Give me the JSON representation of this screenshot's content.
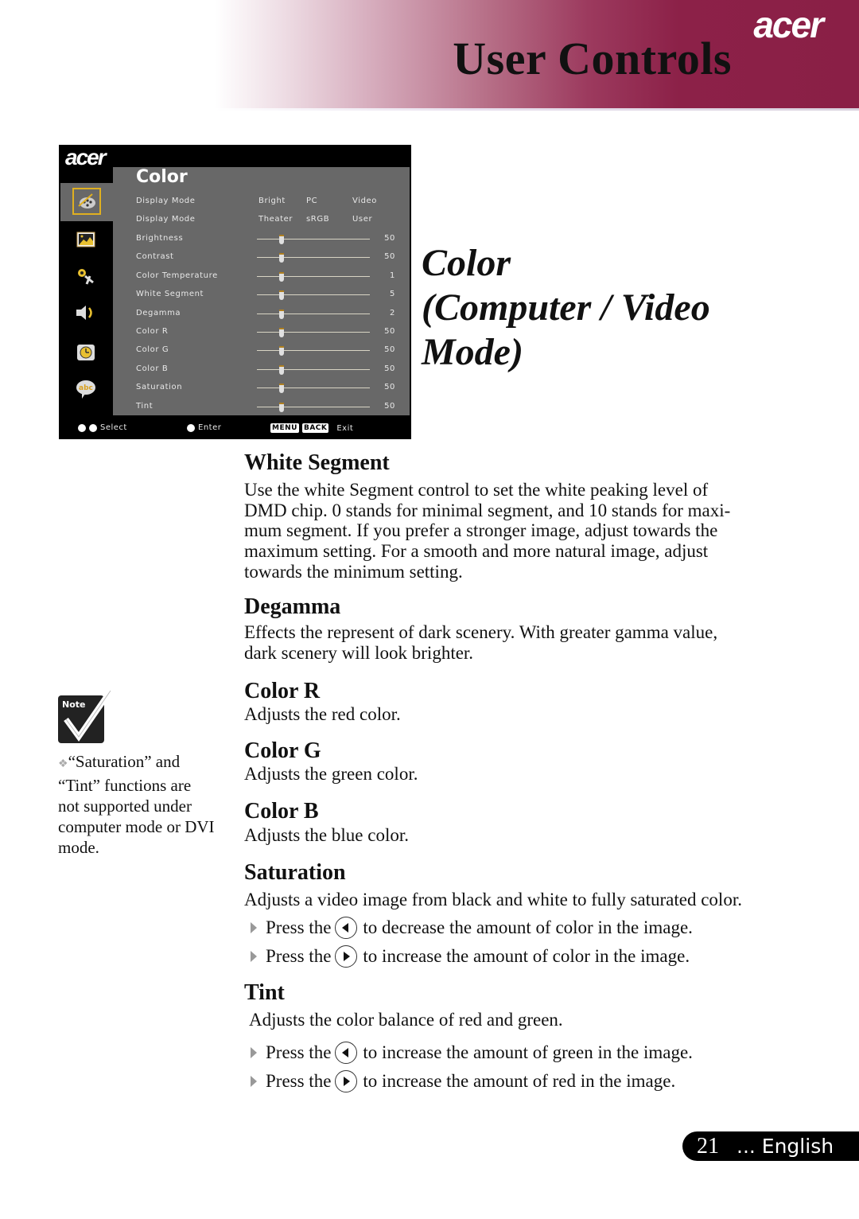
{
  "header": {
    "brand": "acer",
    "title": "User Controls"
  },
  "osd": {
    "brand": "acer",
    "menu_title": "Color",
    "side_icons": [
      {
        "name": "color-palette-icon",
        "selected": true
      },
      {
        "name": "image-icon",
        "selected": false
      },
      {
        "name": "settings-icon",
        "selected": false
      },
      {
        "name": "audio-icon",
        "selected": false
      },
      {
        "name": "timer-icon",
        "selected": false
      },
      {
        "name": "language-icon",
        "selected": false
      }
    ],
    "mode_rows": [
      {
        "label": "Display Mode",
        "options": [
          "Bright",
          "PC",
          "Video"
        ]
      },
      {
        "label": "Display Mode",
        "options": [
          "Theater",
          "sRGB",
          "User"
        ]
      }
    ],
    "slider_rows": [
      {
        "label": "Brightness",
        "value": "50",
        "position": 0.22
      },
      {
        "label": "Contrast",
        "value": "50",
        "position": 0.22
      },
      {
        "label": "Color Temperature",
        "value": "1",
        "position": 0.22
      },
      {
        "label": "White Segment",
        "value": "5",
        "position": 0.22
      },
      {
        "label": "Degamma",
        "value": "2",
        "position": 0.22
      },
      {
        "label": "Color R",
        "value": "50",
        "position": 0.22
      },
      {
        "label": "Color G",
        "value": "50",
        "position": 0.22
      },
      {
        "label": "Color B",
        "value": "50",
        "position": 0.22
      },
      {
        "label": "Saturation",
        "value": "50",
        "position": 0.22
      },
      {
        "label": "Tint",
        "value": "50",
        "position": 0.22
      }
    ],
    "footer": {
      "select": "Select",
      "enter": "Enter",
      "menu_key": "MENU",
      "back_key": "BACK",
      "exit": "Exit"
    }
  },
  "caption": {
    "line1": "Color",
    "line2": "(Computer / Video",
    "line3": "Mode)"
  },
  "sections": {
    "white_segment": {
      "title": "White Segment",
      "lines": [
        "Use the white Segment control to set the white peaking level of",
        "DMD chip. 0 stands for minimal segment, and 10 stands for maxi-",
        "mum segment. If you prefer a stronger image, adjust towards the",
        "maximum setting. For a smooth and more natural image, adjust",
        "towards the minimum setting."
      ]
    },
    "degamma": {
      "title": "Degamma",
      "lines": [
        "Effects the represent of dark scenery. With greater gamma value,",
        "dark scenery will look brighter."
      ]
    },
    "color_r": {
      "title": "Color R",
      "body": "Adjusts the red color."
    },
    "color_g": {
      "title": "Color G",
      "body": "Adjusts the green color."
    },
    "color_b": {
      "title": "Color B",
      "body": "Adjusts the blue color."
    },
    "saturation": {
      "title": "Saturation",
      "body": "Adjusts a video image from black and white to fully saturated color.",
      "bullets": [
        {
          "prefix": "Press the",
          "button": "left",
          "suffix": "to decrease the amount of color in the image."
        },
        {
          "prefix": "Press the",
          "button": "right",
          "suffix": "to increase the amount of color in the image."
        }
      ]
    },
    "tint": {
      "title": "Tint",
      "body": "Adjusts the color balance of red and green.",
      "bullets": [
        {
          "prefix": "Press the",
          "button": "left",
          "suffix": "to increase the amount of green in the image."
        },
        {
          "prefix": "Press the",
          "button": "right",
          "suffix": "to increase the amount of red in the image."
        }
      ]
    }
  },
  "note": {
    "badge": "Note",
    "lines": [
      "“Saturation” and",
      "“Tint” functions are",
      "not supported under",
      "computer mode or DVI",
      "mode."
    ]
  },
  "footer": {
    "page_number": "21",
    "language": "... English"
  }
}
